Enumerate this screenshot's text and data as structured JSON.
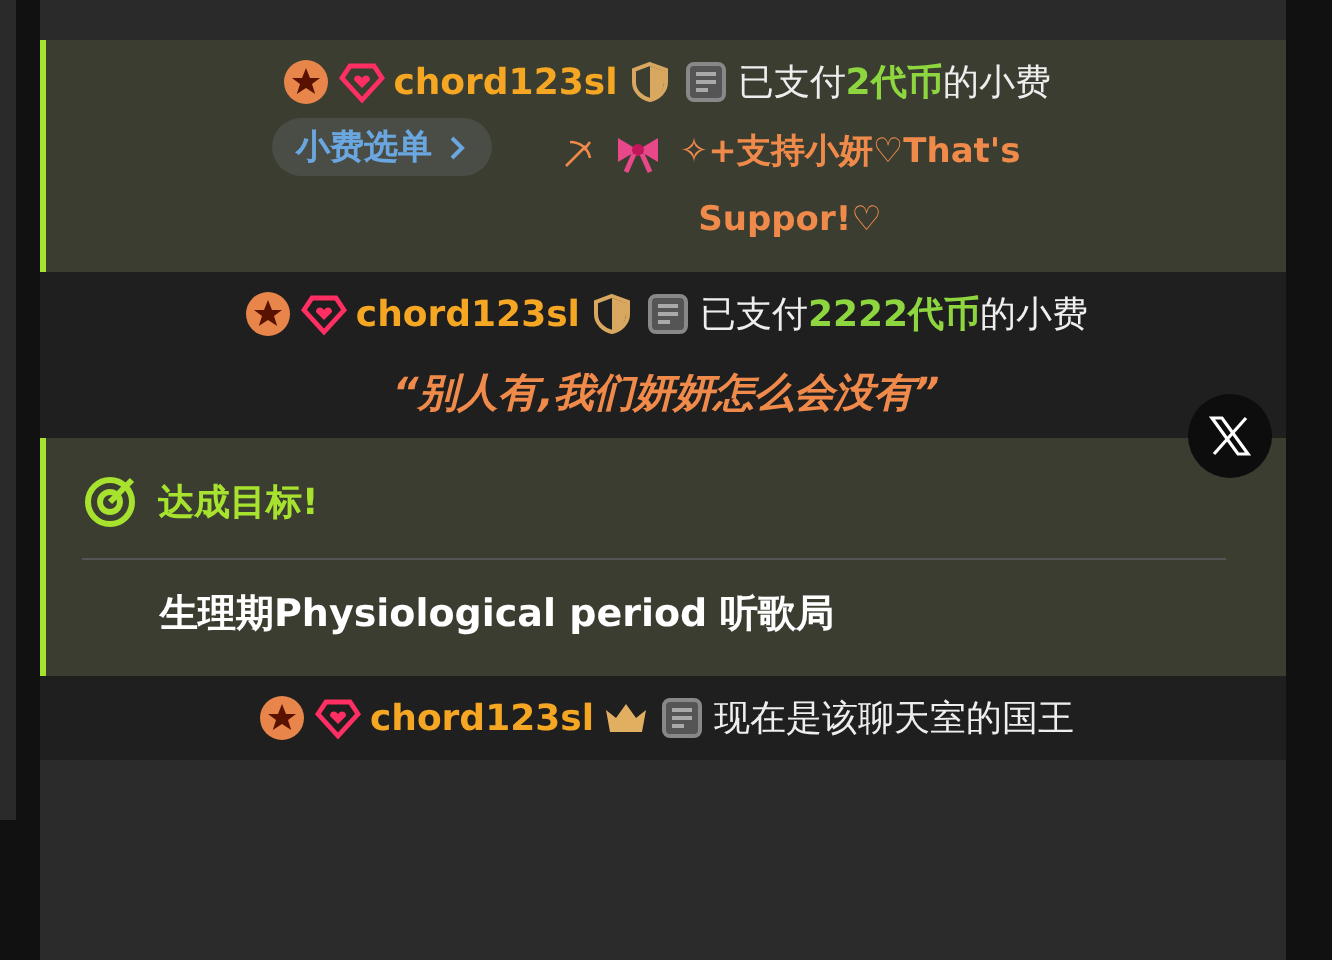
{
  "messages": [
    {
      "kind": "tip",
      "highlighted": true,
      "user": "chord123sl",
      "badge": {
        "kind": "shield"
      },
      "pre": "已支付",
      "amount": "2代币",
      "post": "的小费",
      "menu_button": "小费选单",
      "note": "✧+支持小妍♡That's Suppor!♡"
    },
    {
      "kind": "tip",
      "highlighted": false,
      "user": "chord123sl",
      "badge": {
        "kind": "shield"
      },
      "pre": "已支付",
      "amount": "2222代币",
      "post": "的小费",
      "quote": "“别人有,我们妍妍怎么会没有”"
    },
    {
      "kind": "goal",
      "title": "达成目标!",
      "text": "生理期Physiological period 听歌局"
    },
    {
      "kind": "system",
      "user": "chord123sl",
      "badge": {
        "kind": "crown"
      },
      "text": "现在是该聊天室的国王"
    }
  ]
}
